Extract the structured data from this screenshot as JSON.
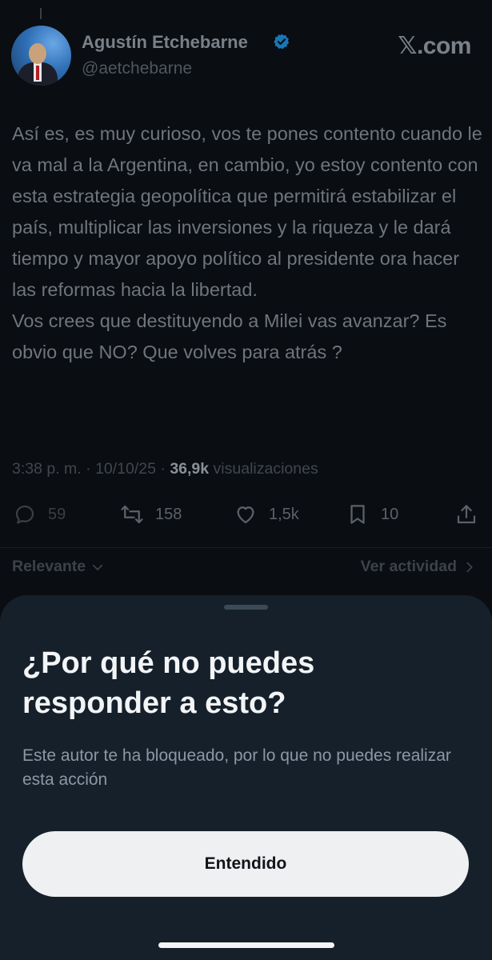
{
  "post": {
    "author_name": "Agustín Etchebarne",
    "author_handle": "@aetchebarne",
    "brand": "𝕏.com",
    "text": "Así es, es muy curioso, vos te pones contento cuando le va mal a la Argentina, en cambio, yo estoy contento con esta estrategia geopolítica que permitirá estabilizar el país, multiplicar las inversiones y la riqueza y le dará tiempo y mayor apoyo político al presidente ora hacer las reformas hacia la libertad.\nVos crees que destituyendo a Milei vas avanzar? Es obvio que NO? Que volves para atrás ?",
    "time": "3:38 p. m.",
    "date": "10/10/25",
    "views_count": "36,9k",
    "views_label": "visualizaciones",
    "separator": "·"
  },
  "actions": {
    "replies": "59",
    "reposts": "158",
    "likes": "1,5k",
    "bookmarks": "10"
  },
  "filters": {
    "sort_label": "Relevante",
    "activity_label": "Ver actividad"
  },
  "sheet": {
    "title": "¿Por qué no puedes responder a esto?",
    "description": "Este autor te ha bloqueado, por lo que no puedes realizar esta acción",
    "button_label": "Entendido"
  },
  "colors": {
    "verified": "#1d9bf0",
    "sheet_background": "#16202a",
    "button_background": "#eef0f2"
  }
}
